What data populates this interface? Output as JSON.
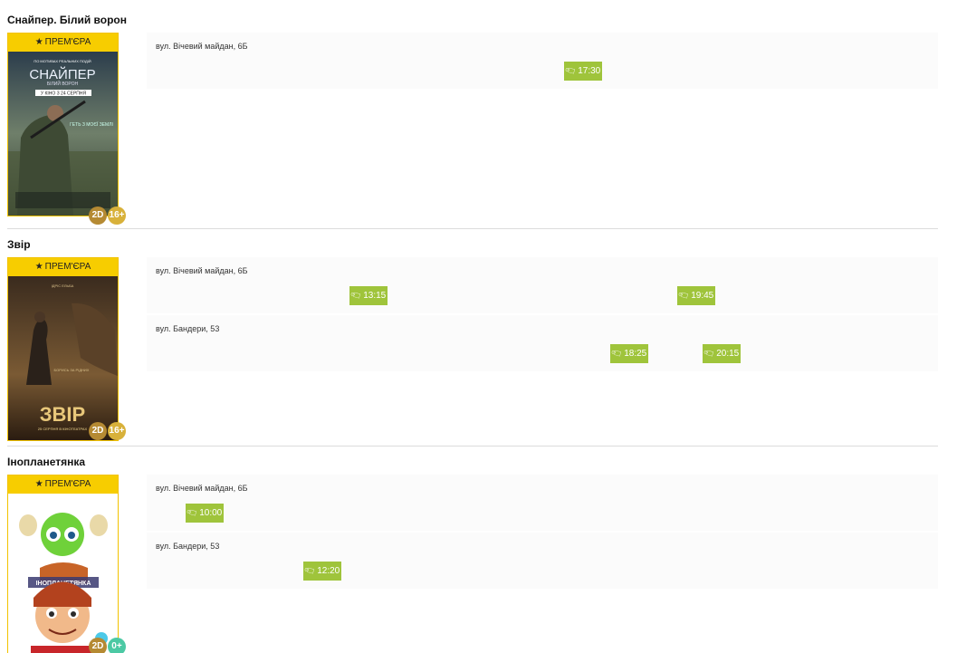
{
  "premiere_label": "ПРЕМ'ЄРА",
  "colors": {
    "premiere_bg": "#f7cd00",
    "showtime_bg": "#9fc43b",
    "format_badge": "#b58a33",
    "age_badge": "#d8b13a",
    "age_badge_kids": "#4cc9a4"
  },
  "movies": [
    {
      "title": "Снайпер. Білий ворон",
      "format": "2D",
      "age": "16+",
      "poster": {
        "top_line": "ПО МОТИВАХ РЕАЛЬНИХ ПОДІЙ",
        "title": "СНАЙПЕР",
        "subtitle": "БІЛИЙ ВОРОН",
        "release": "У КІНО З 24 СЕРПНЯ",
        "tagline": "ГЕТЬ З МОЄЇ ЗЕМЛІ"
      },
      "cinemas": [
        {
          "address": "вул. Вічевий майдан, 6Б",
          "times": [
            "17:30"
          ]
        }
      ]
    },
    {
      "title": "Звір",
      "format": "2D",
      "age": "16+",
      "poster": {
        "top_line": "ІДРІС ЕЛЬБА",
        "title": "ЗВІР",
        "release": "25 СЕРПНЯ В КІНОТЕАТРАХ",
        "tagline": "БОРИСЬ ЗА РІДНИХ"
      },
      "cinemas": [
        {
          "address": "вул. Вічевий майдан, 6Б",
          "times": [
            "13:15",
            "19:45"
          ]
        },
        {
          "address": "вул. Бандери, 53",
          "times": [
            "18:25",
            "20:15"
          ]
        }
      ]
    },
    {
      "title": "Інопланетянка",
      "format": "2D",
      "age": "0+",
      "poster": {
        "title": "ІНОПЛАНЕТЯНКА"
      },
      "cinemas": [
        {
          "address": "вул. Вічевий майдан, 6Б",
          "times": [
            "10:00"
          ]
        },
        {
          "address": "вул. Бандери, 53",
          "times": [
            "12:20"
          ]
        }
      ]
    }
  ]
}
